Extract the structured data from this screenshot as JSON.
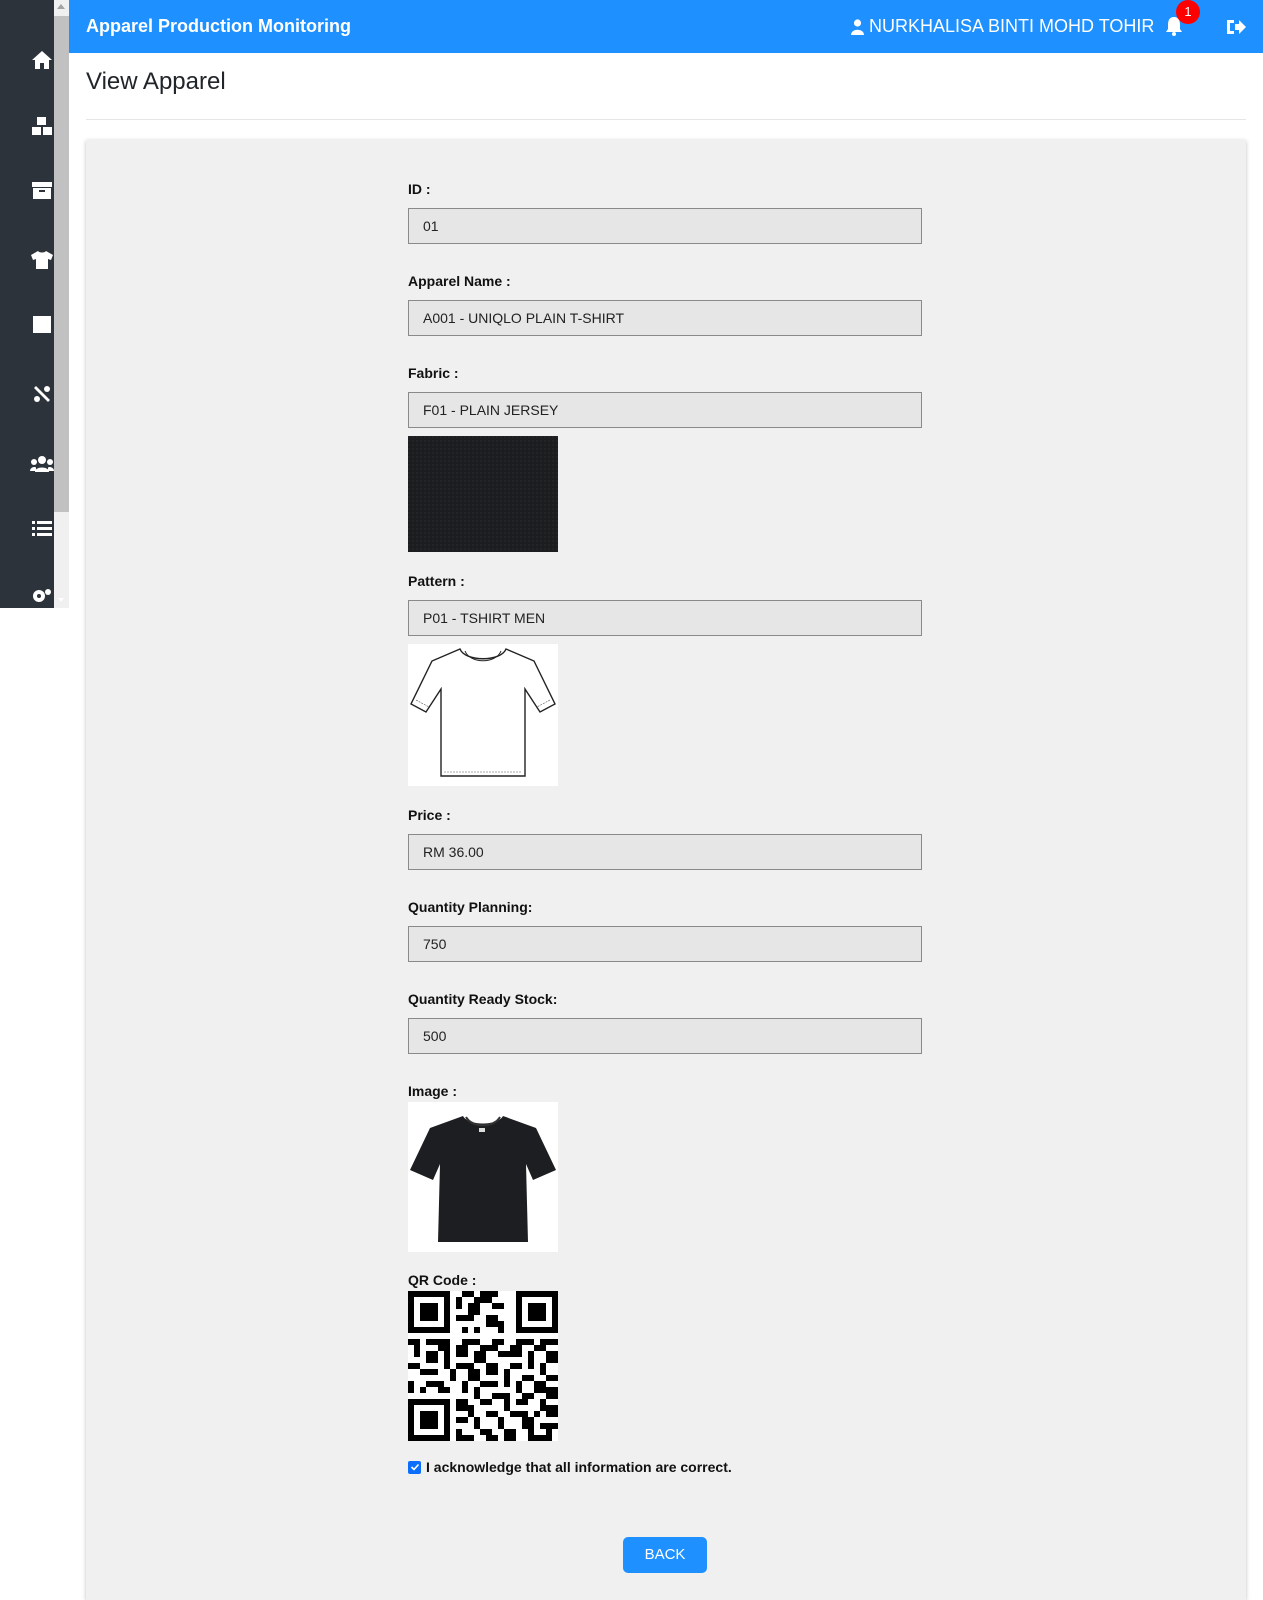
{
  "app": {
    "title": "Apparel Production Monitoring"
  },
  "header": {
    "user_name": "NURKHALISA BINTI MOHD TOHIR",
    "notification_count": "1"
  },
  "sidebar": {
    "items": [
      {
        "icon": "home-icon"
      },
      {
        "icon": "boxes-icon"
      },
      {
        "icon": "archive-icon"
      },
      {
        "icon": "tshirt-icon"
      },
      {
        "icon": "square-icon"
      },
      {
        "icon": "tools-icon"
      },
      {
        "icon": "users-icon"
      },
      {
        "icon": "list-icon"
      },
      {
        "icon": "gears-icon"
      }
    ]
  },
  "page": {
    "title": "View Apparel"
  },
  "form": {
    "id_label": "ID :",
    "id_value": "01",
    "name_label": "Apparel Name :",
    "name_value": "A001 - UNIQLO PLAIN T-SHIRT",
    "fabric_label": "Fabric :",
    "fabric_value": "F01 - PLAIN JERSEY",
    "pattern_label": "Pattern :",
    "pattern_value": "P01 - TSHIRT MEN",
    "price_label": "Price :",
    "price_value": "RM 36.00",
    "qty_planning_label": "Quantity Planning:",
    "qty_planning_value": "750",
    "qty_ready_label": "Quantity Ready Stock:",
    "qty_ready_value": "500",
    "image_label": "Image :",
    "qr_label": "QR Code :",
    "acknowledge_text": "I acknowledge that all information are correct.",
    "acknowledge_checked": true,
    "back_label": "BACK"
  },
  "colors": {
    "header": "#1e90ff",
    "sidebar": "#2c333b",
    "card": "#f0f0f0",
    "badge": "#ff0000"
  }
}
